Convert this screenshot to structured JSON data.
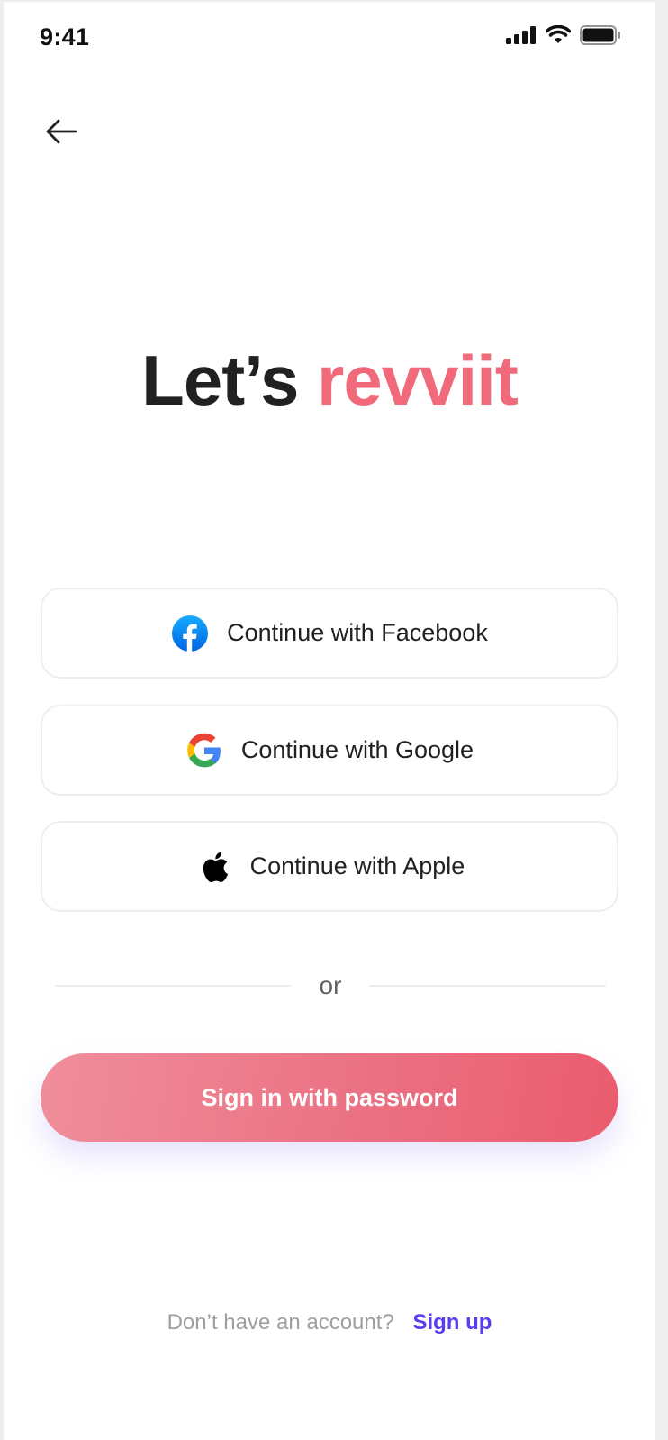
{
  "status_bar": {
    "time": "9:41"
  },
  "header": {
    "back_icon": "arrow-left-icon"
  },
  "title": {
    "prefix": "Let’s",
    "brand": "revviit",
    "brand_color": "#f06a7b"
  },
  "social": {
    "facebook_label": "Continue with Facebook",
    "google_label": "Continue with Google",
    "apple_label": "Continue with Apple"
  },
  "divider": {
    "text": "or"
  },
  "primary_button": {
    "label": "Sign in with password"
  },
  "footer": {
    "prompt": "Don’t have an account?",
    "link": "Sign up",
    "link_color": "#5b3df0"
  }
}
